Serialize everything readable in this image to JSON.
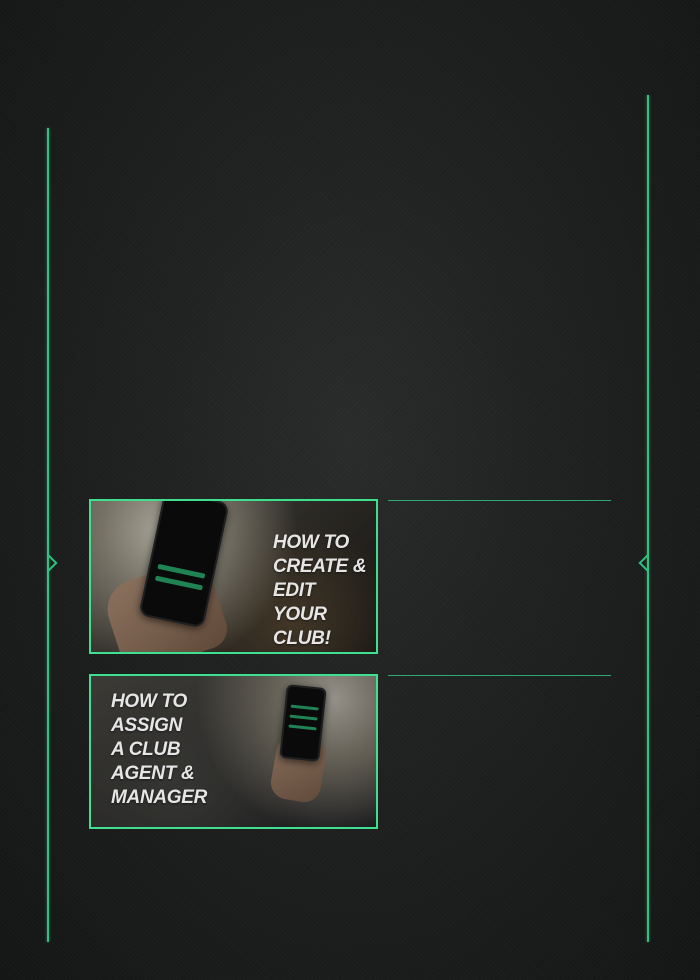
{
  "colors": {
    "accent": "#2ec27e",
    "card_border": "#3ee08f",
    "background": "#1b1c1c",
    "title_text": "#e6e6e6"
  },
  "cards": [
    {
      "title_lines": [
        "HOW TO",
        "CREATE &",
        "EDIT YOUR",
        "CLUB!"
      ],
      "icon": "smartphone-in-hand"
    },
    {
      "title_lines": [
        "HOW TO",
        "ASSIGN",
        "A CLUB",
        "AGENT &",
        "MANAGER"
      ],
      "icon": "smartphone-in-hand"
    }
  ]
}
